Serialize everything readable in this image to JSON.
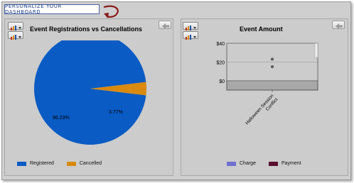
{
  "personalize_tab": {
    "label": "Personalize your Dashboard"
  },
  "panels": [
    {
      "title": "Event Registrations vs Cancellations",
      "legend": [
        {
          "label": "Registered",
          "color": "#0a5bc4"
        },
        {
          "label": "Cancelled",
          "color": "#d98a10"
        }
      ]
    },
    {
      "title": "Event  Amount",
      "legend": [
        {
          "label": "Charge",
          "color": "#6f6fd0"
        },
        {
          "label": "Payment",
          "color": "#5a0f2e"
        }
      ]
    }
  ],
  "chart_data": [
    {
      "type": "pie",
      "title": "Event Registrations vs Cancellations",
      "slices": [
        {
          "label": "Registered",
          "value": 96.23,
          "value_label": "96.23%",
          "color": "#0a5bc4"
        },
        {
          "label": "Cancelled",
          "value": 3.77,
          "value_label": "3.77%",
          "color": "#d98a10"
        }
      ],
      "legend_position": "bottom"
    },
    {
      "type": "scatter",
      "title": "Event  Amount",
      "categories": [
        "Halloween Session Conflict"
      ],
      "ylim": [
        -10,
        40
      ],
      "yticks": [
        "$40",
        "$20",
        "$0"
      ],
      "ytick_values": [
        40,
        20,
        0
      ],
      "points": [
        {
          "x": "Halloween Session Conflict",
          "y": 23
        },
        {
          "x": "Halloween Session Conflict",
          "y": 15
        }
      ],
      "legend_position": "bottom"
    }
  ]
}
